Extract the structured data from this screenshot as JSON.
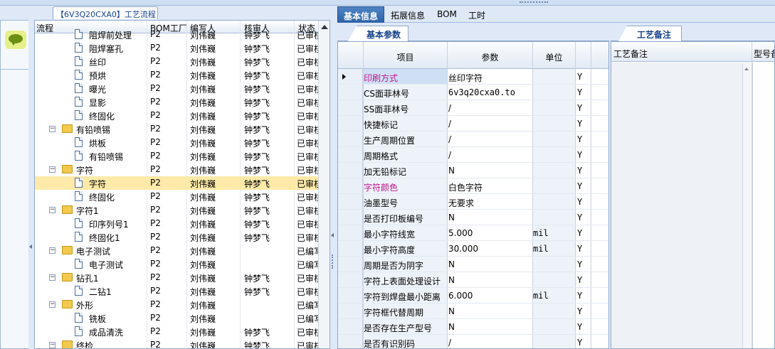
{
  "window": {
    "breadcrumb": "【6V3Q20CXA0】工艺流程"
  },
  "tree": {
    "columns": [
      "流程",
      "BOM工厂",
      "编写人",
      "核审人",
      "状态"
    ],
    "rows": [
      {
        "name": "阻焊前处理",
        "level": 2,
        "type": "doc",
        "bom": "P2",
        "writer": "刘伟巍",
        "reviewer": "钟梦飞",
        "status": "已审核"
      },
      {
        "name": "阻焊塞孔",
        "level": 2,
        "type": "doc",
        "bom": "P2",
        "writer": "刘伟巍",
        "reviewer": "钟梦飞",
        "status": "已审核"
      },
      {
        "name": "丝印",
        "level": 2,
        "type": "doc",
        "bom": "P2",
        "writer": "刘伟巍",
        "reviewer": "钟梦飞",
        "status": "已审核"
      },
      {
        "name": "预烘",
        "level": 2,
        "type": "doc",
        "bom": "P2",
        "writer": "刘伟巍",
        "reviewer": "钟梦飞",
        "status": "已审核"
      },
      {
        "name": "曝光",
        "level": 2,
        "type": "doc",
        "bom": "P2",
        "writer": "刘伟巍",
        "reviewer": "钟梦飞",
        "status": "已审核"
      },
      {
        "name": "显影",
        "level": 2,
        "type": "doc",
        "bom": "P2",
        "writer": "刘伟巍",
        "reviewer": "钟梦飞",
        "status": "已审核"
      },
      {
        "name": "终固化",
        "level": 2,
        "type": "doc",
        "bom": "P2",
        "writer": "刘伟巍",
        "reviewer": "钟梦飞",
        "status": "已审核"
      },
      {
        "name": "有铅喷锡",
        "level": 1,
        "type": "folder",
        "bom": "P2",
        "writer": "刘伟巍",
        "reviewer": "钟梦飞",
        "status": "已审核"
      },
      {
        "name": "烘板",
        "level": 2,
        "type": "doc",
        "bom": "P2",
        "writer": "刘伟巍",
        "reviewer": "钟梦飞",
        "status": "已审核"
      },
      {
        "name": "有铅喷锡",
        "level": 2,
        "type": "doc",
        "bom": "P2",
        "writer": "刘伟巍",
        "reviewer": "钟梦飞",
        "status": "已审核"
      },
      {
        "name": "字符",
        "level": 1,
        "type": "folder",
        "bom": "P2",
        "writer": "刘伟巍",
        "reviewer": "钟梦飞",
        "status": "已审核"
      },
      {
        "name": "字符",
        "level": 2,
        "type": "doc",
        "bom": "P2",
        "writer": "刘伟巍",
        "reviewer": "钟梦飞",
        "status": "已审核",
        "selected": true
      },
      {
        "name": "终固化",
        "level": 2,
        "type": "doc",
        "bom": "P2",
        "writer": "刘伟巍",
        "reviewer": "钟梦飞",
        "status": "已审核"
      },
      {
        "name": "字符1",
        "level": 1,
        "type": "folder",
        "bom": "P2",
        "writer": "刘伟巍",
        "reviewer": "钟梦飞",
        "status": "已审核"
      },
      {
        "name": "印序列号1",
        "level": 2,
        "type": "doc",
        "bom": "P2",
        "writer": "刘伟巍",
        "reviewer": "钟梦飞",
        "status": "已审核"
      },
      {
        "name": "终固化1",
        "level": 2,
        "type": "doc",
        "bom": "P2",
        "writer": "刘伟巍",
        "reviewer": "钟梦飞",
        "status": "已审核"
      },
      {
        "name": "电子测试",
        "level": 1,
        "type": "folder",
        "bom": "P2",
        "writer": "刘伟巍",
        "reviewer": "",
        "status": "已编写"
      },
      {
        "name": "电子测试",
        "level": 2,
        "type": "doc",
        "bom": "P2",
        "writer": "刘伟巍",
        "reviewer": "",
        "status": "已编写"
      },
      {
        "name": "钻孔1",
        "level": 1,
        "type": "folder",
        "bom": "P2",
        "writer": "刘伟巍",
        "reviewer": "钟梦飞",
        "status": "已审核"
      },
      {
        "name": "二钻1",
        "level": 2,
        "type": "doc",
        "bom": "P2",
        "writer": "刘伟巍",
        "reviewer": "钟梦飞",
        "status": "已审核"
      },
      {
        "name": "外形",
        "level": 1,
        "type": "folder",
        "bom": "P2",
        "writer": "刘伟巍",
        "reviewer": "",
        "status": "已编写"
      },
      {
        "name": "铣板",
        "level": 2,
        "type": "doc",
        "bom": "P2",
        "writer": "刘伟巍",
        "reviewer": "",
        "status": "已编写"
      },
      {
        "name": "成品清洗",
        "level": 2,
        "type": "doc",
        "bom": "P2",
        "writer": "刘伟巍",
        "reviewer": "钟梦飞",
        "status": "已审核"
      },
      {
        "name": "终检",
        "level": 1,
        "type": "folder",
        "bom": "P2",
        "writer": "刘伟巍",
        "reviewer": "钟梦飞",
        "status": "已审核"
      }
    ]
  },
  "main_tabs": [
    "基本信息",
    "拓展信息",
    "BOM",
    "工时"
  ],
  "params_panel": {
    "tab": "基本参数",
    "columns": {
      "item": "项目",
      "param": "参数",
      "unit": "单位"
    },
    "rows": [
      {
        "item": "印刷方式",
        "value": "丝印字符",
        "unit": "",
        "flag": "Y",
        "highlight": true,
        "current": true
      },
      {
        "item": "CS面菲林号",
        "value": "6v3q20cxa0.to",
        "unit": "",
        "flag": "Y",
        "mono": true
      },
      {
        "item": "SS面菲林号",
        "value": "/",
        "unit": "",
        "flag": "Y"
      },
      {
        "item": "快捷标记",
        "value": "/",
        "unit": "",
        "flag": "Y"
      },
      {
        "item": "生产周期位置",
        "value": "/",
        "unit": "",
        "flag": "Y"
      },
      {
        "item": "周期格式",
        "value": "/",
        "unit": "",
        "flag": "Y"
      },
      {
        "item": "加无铅标记",
        "value": "N",
        "unit": "",
        "flag": "Y"
      },
      {
        "item": "字符颜色",
        "value": "白色字符",
        "unit": "",
        "flag": "Y",
        "highlight": true
      },
      {
        "item": "油墨型号",
        "value": "无要求",
        "unit": "",
        "flag": "Y"
      },
      {
        "item": "是否打印板编号",
        "value": "N",
        "unit": "",
        "flag": "Y"
      },
      {
        "item": "最小字符线宽",
        "value": "5.000",
        "unit": "mil",
        "flag": "Y"
      },
      {
        "item": "最小字符高度",
        "value": "30.000",
        "unit": "mil",
        "flag": "Y"
      },
      {
        "item": "周期是否为阴字",
        "value": "N",
        "unit": "",
        "flag": "Y"
      },
      {
        "item": "字符上表面处理设计",
        "value": "N",
        "unit": "",
        "flag": "Y"
      },
      {
        "item": "字符到焊盘最小距离",
        "value": "6.000",
        "unit": "mil",
        "flag": "Y"
      },
      {
        "item": "字符框代替周期",
        "value": "N",
        "unit": "",
        "flag": "Y"
      },
      {
        "item": "是否存在生产型号",
        "value": "N",
        "unit": "",
        "flag": "Y"
      },
      {
        "item": "是否有识别码",
        "value": "/",
        "unit": "",
        "flag": "Y"
      }
    ]
  },
  "notes_panel": {
    "tab": "工艺备注",
    "columns": [
      "工艺备注",
      "型号备"
    ]
  },
  "colors": {
    "highlight_text": "#c0168c",
    "selected_row": "#fde9a8",
    "tab_active": "#2c63a8"
  }
}
